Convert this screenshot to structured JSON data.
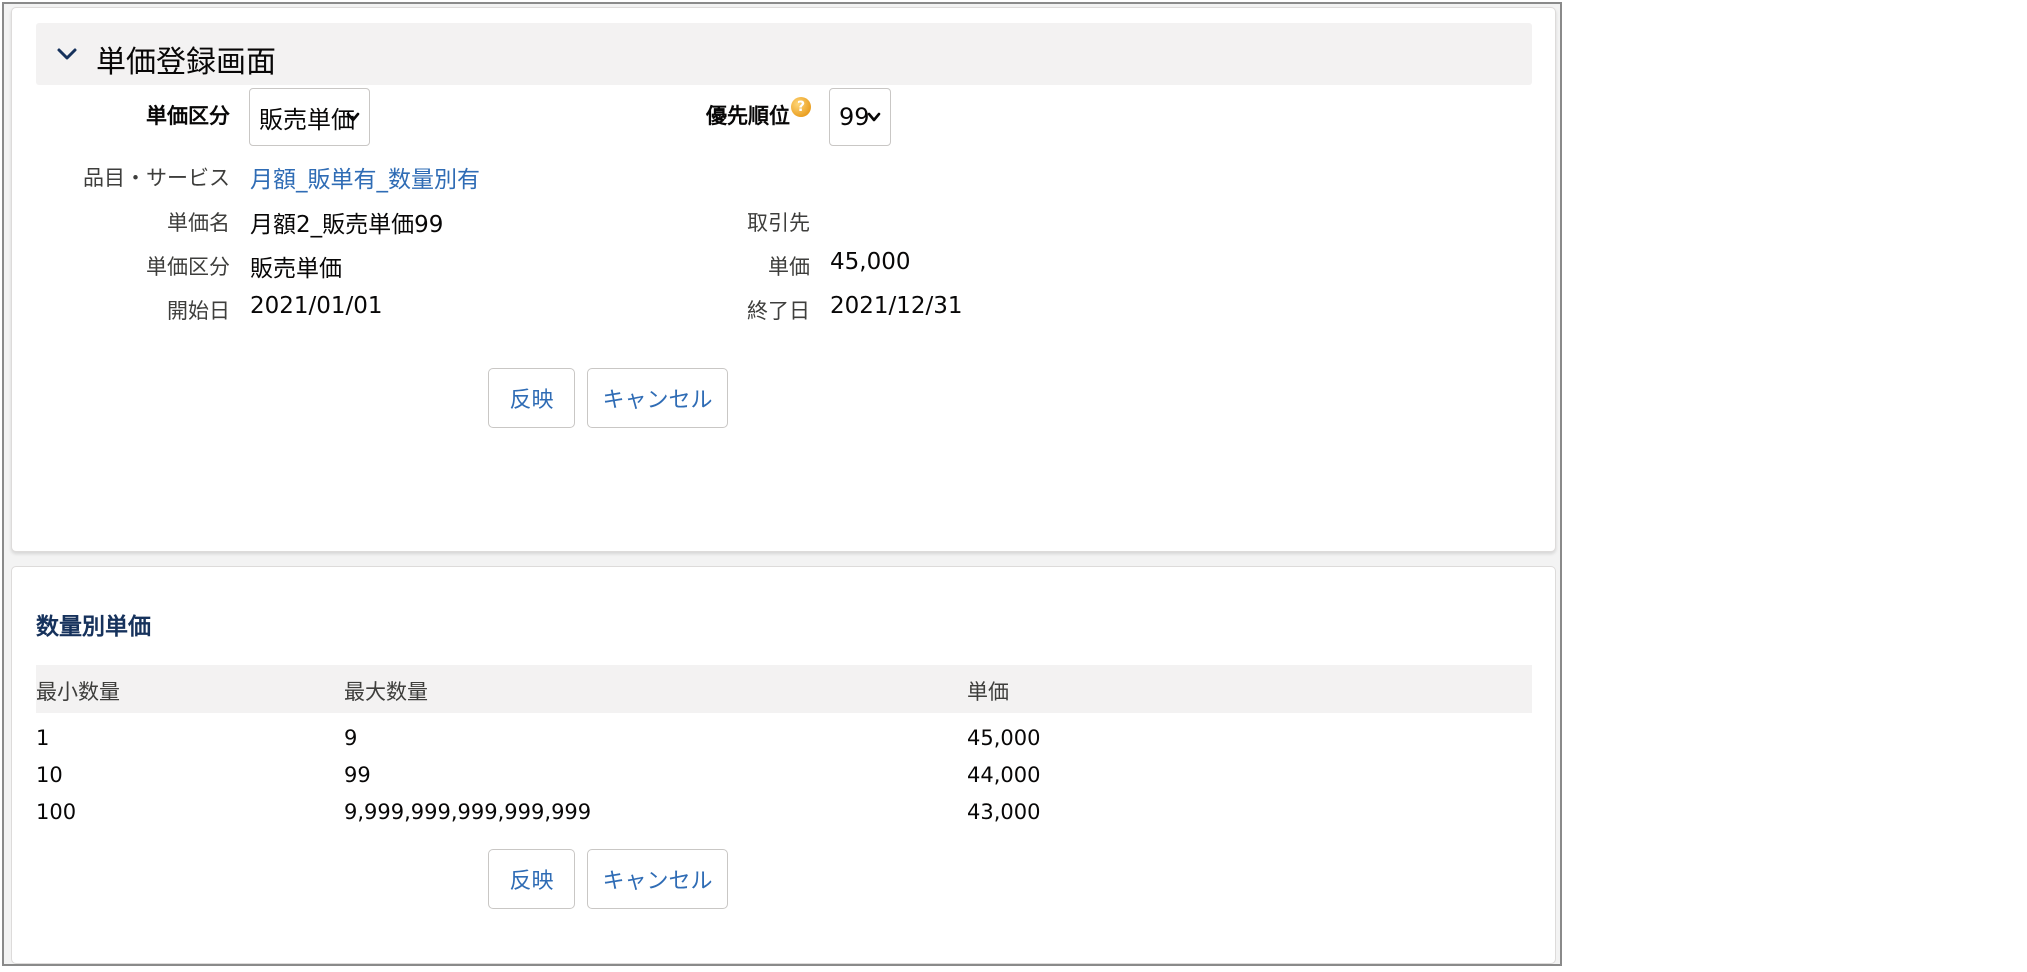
{
  "header": {
    "title": "単価登録画面"
  },
  "selectors": {
    "price_type_label": "単価区分",
    "price_type_value": "販売単価",
    "priority_label": "優先順位",
    "priority_value": "99"
  },
  "fields": {
    "item_label": "品目・サービス",
    "item_value": "月額_販単有_数量別有",
    "name_label": "単価名",
    "name_value": "月額2_販売単価99",
    "partner_label": "取引先",
    "partner_value": "",
    "type_label": "単価区分",
    "type_value": "販売単価",
    "price_label": "単価",
    "price_value": "45,000",
    "start_label": "開始日",
    "start_value": "2021/01/01",
    "end_label": "終了日",
    "end_value": "2021/12/31"
  },
  "actions1": {
    "apply": "反映",
    "cancel": "キャンセル"
  },
  "quantity": {
    "title": "数量別単価",
    "headers": [
      "最小数量",
      "最大数量",
      "単価"
    ],
    "rows": [
      [
        "1",
        "9",
        "45,000"
      ],
      [
        "10",
        "99",
        "44,000"
      ],
      [
        "100",
        "9,999,999,999,999,999",
        "43,000"
      ]
    ]
  },
  "actions2": {
    "apply": "反映",
    "cancel": "キャンセル"
  },
  "colors": {
    "link": "#2f6cb5",
    "header_bg": "#f3f2f2",
    "help_icon": "#e28a00"
  }
}
